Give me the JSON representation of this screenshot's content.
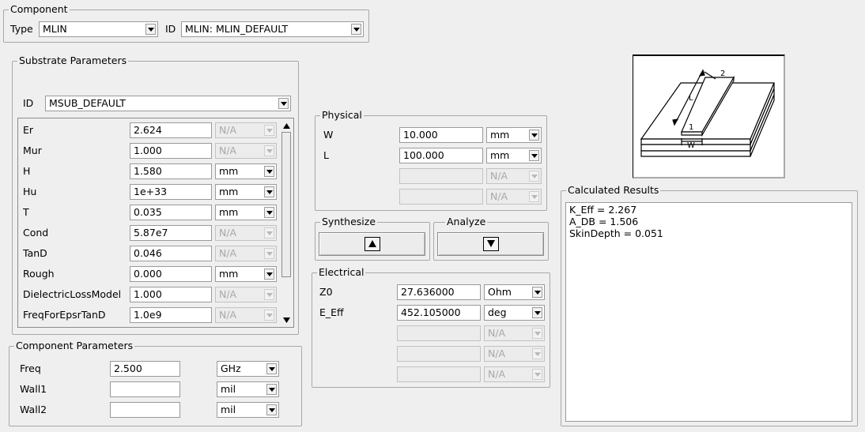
{
  "component": {
    "title": "Component",
    "type_label": "Type",
    "type_value": "MLIN",
    "id_label": "ID",
    "id_value": "MLIN: MLIN_DEFAULT"
  },
  "substrate": {
    "title": "Substrate Parameters",
    "id_label": "ID",
    "id_value": "MSUB_DEFAULT",
    "params": [
      {
        "name": "Er",
        "value": "2.624",
        "unit": "N/A"
      },
      {
        "name": "Mur",
        "value": "1.000",
        "unit": "N/A"
      },
      {
        "name": "H",
        "value": "1.580",
        "unit": "mm"
      },
      {
        "name": "Hu",
        "value": "1e+33",
        "unit": "mm"
      },
      {
        "name": "T",
        "value": "0.035",
        "unit": "mm"
      },
      {
        "name": "Cond",
        "value": "5.87e7",
        "unit": "N/A"
      },
      {
        "name": "TanD",
        "value": "0.046",
        "unit": "N/A"
      },
      {
        "name": "Rough",
        "value": "0.000",
        "unit": "mm"
      },
      {
        "name": "DielectricLossModel",
        "value": "1.000",
        "unit": "N/A"
      },
      {
        "name": "FreqForEpsrTanD",
        "value": "1.0e9",
        "unit": "N/A"
      }
    ]
  },
  "component_params": {
    "title": "Component Parameters",
    "params": [
      {
        "name": "Freq",
        "value": "2.500",
        "unit": "GHz"
      },
      {
        "name": "Wall1",
        "value": "",
        "unit": "mil"
      },
      {
        "name": "Wall2",
        "value": "",
        "unit": "mil"
      }
    ]
  },
  "physical": {
    "title": "Physical",
    "params": [
      {
        "name": "W",
        "value": "10.000",
        "unit": "mm"
      },
      {
        "name": "L",
        "value": "100.000",
        "unit": "mm"
      },
      {
        "name": "",
        "value": "",
        "unit": "N/A"
      },
      {
        "name": "",
        "value": "",
        "unit": "N/A"
      }
    ]
  },
  "synthesize": {
    "title": "Synthesize",
    "icon": "arrow-up-icon"
  },
  "analyze": {
    "title": "Analyze",
    "icon": "arrow-down-icon"
  },
  "electrical": {
    "title": "Electrical",
    "params": [
      {
        "name": "Z0",
        "value": "27.636000",
        "unit": "Ohm"
      },
      {
        "name": "E_Eff",
        "value": "452.105000",
        "unit": "deg"
      },
      {
        "name": "",
        "value": "",
        "unit": "N/A"
      },
      {
        "name": "",
        "value": "",
        "unit": "N/A"
      },
      {
        "name": "",
        "value": "",
        "unit": "N/A"
      }
    ]
  },
  "results": {
    "title": "Calculated Results",
    "lines": [
      "K_Eff = 2.267",
      "A_DB = 1.506",
      "SkinDepth = 0.051"
    ]
  },
  "diagram": {
    "label_length": "L",
    "label_width": "W",
    "port1": "1",
    "port2": "2"
  }
}
